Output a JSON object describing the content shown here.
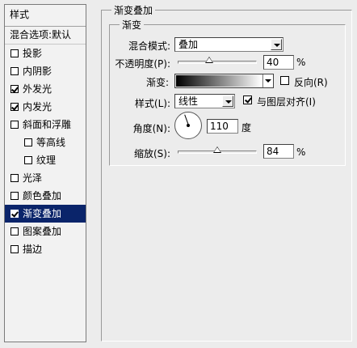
{
  "sidebar": {
    "header": "样式",
    "blend_options": "混合选项:默认",
    "items": [
      {
        "label": "投影",
        "checked": false,
        "indent": false,
        "selected": false
      },
      {
        "label": "内阴影",
        "checked": false,
        "indent": false,
        "selected": false
      },
      {
        "label": "外发光",
        "checked": true,
        "indent": false,
        "selected": false
      },
      {
        "label": "内发光",
        "checked": true,
        "indent": false,
        "selected": false
      },
      {
        "label": "斜面和浮雕",
        "checked": false,
        "indent": false,
        "selected": false
      },
      {
        "label": "等高线",
        "checked": false,
        "indent": true,
        "selected": false
      },
      {
        "label": "纹理",
        "checked": false,
        "indent": true,
        "selected": false
      },
      {
        "label": "光泽",
        "checked": false,
        "indent": false,
        "selected": false
      },
      {
        "label": "颜色叠加",
        "checked": false,
        "indent": false,
        "selected": false
      },
      {
        "label": "渐变叠加",
        "checked": true,
        "indent": false,
        "selected": true
      },
      {
        "label": "图案叠加",
        "checked": false,
        "indent": false,
        "selected": false
      },
      {
        "label": "描边",
        "checked": false,
        "indent": false,
        "selected": false
      }
    ]
  },
  "panel": {
    "title": "渐变叠加",
    "group_title": "渐变",
    "blend_mode_label": "混合模式:",
    "blend_mode_value": "叠加",
    "opacity_label": "不透明度(P):",
    "opacity_value": "40",
    "opacity_fraction": 0.4,
    "gradient_label": "渐变:",
    "reverse_label": "反向(R)",
    "reverse_checked": false,
    "style_label": "样式(L):",
    "style_value": "线性",
    "align_label": "与图层对齐(I)",
    "align_checked": true,
    "angle_label": "角度(N):",
    "angle_value": "110",
    "angle_degrees": 110,
    "angle_unit": "度",
    "scale_label": "缩放(S):",
    "scale_value": "84",
    "scale_fraction": 0.5,
    "percent": "%"
  },
  "colors": {
    "selection": "#0a246a",
    "background": "#ececec"
  }
}
